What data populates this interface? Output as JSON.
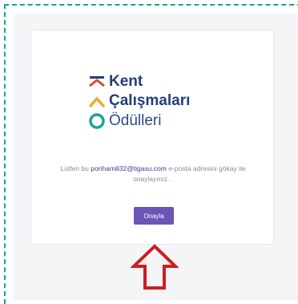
{
  "logo": {
    "line1": "Kent",
    "line2": "Çalışmaları",
    "line3": "Ödülleri",
    "colors": {
      "navy": "#253e78",
      "red": "#d94a3a",
      "orange": "#f0a93a",
      "teal": "#1aa39a"
    }
  },
  "message": {
    "prefix": "Lütfen bu",
    "email": "poriham832@tigasu.com",
    "suffix": "e-posta adresini gökay ile onaylayınız. ."
  },
  "confirm_button": {
    "label": "Onayla",
    "color": "#6b55b8"
  },
  "annotation": {
    "arrow_icon": "up-arrow-outline-icon",
    "color": "#cc1f1f",
    "frame_color": "#1aa39a"
  }
}
